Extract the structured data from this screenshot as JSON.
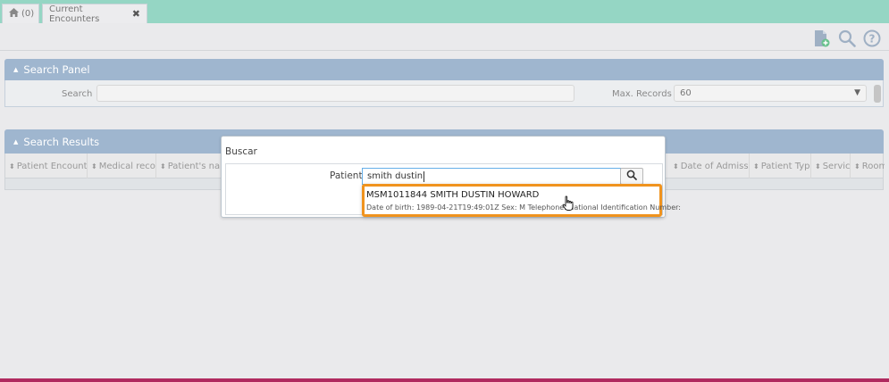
{
  "tabs": {
    "home_count": "(0)",
    "current": "Current Encounters",
    "close_glyph": "✖"
  },
  "toolbar": {
    "icons": [
      "new-document-icon",
      "search-icon",
      "help-icon"
    ]
  },
  "search_panel": {
    "title": "Search Panel",
    "search_label": "Search",
    "search_value": "",
    "max_records_label": "Max. Records",
    "max_records_value": "60"
  },
  "search_results": {
    "title": "Search Results",
    "columns": [
      "Patient Encounter",
      "Medical record",
      "Patient's name",
      "Date of Admission",
      "Patient Type",
      "Service",
      "Room"
    ]
  },
  "dialog": {
    "title": "Buscar",
    "patient_label": "Patient",
    "patient_value": "smith dustin"
  },
  "suggestion": {
    "line1": "MSM1011844 SMITH DUSTIN HOWARD",
    "line2": "Date of birth: 1989-04-21T19:49:01Z Sex: M Telephone: National Identification Number:"
  },
  "colors": {
    "topbar": "#95d6c4",
    "panel_header": "#9fb6cf",
    "highlight": "#f0931e"
  }
}
